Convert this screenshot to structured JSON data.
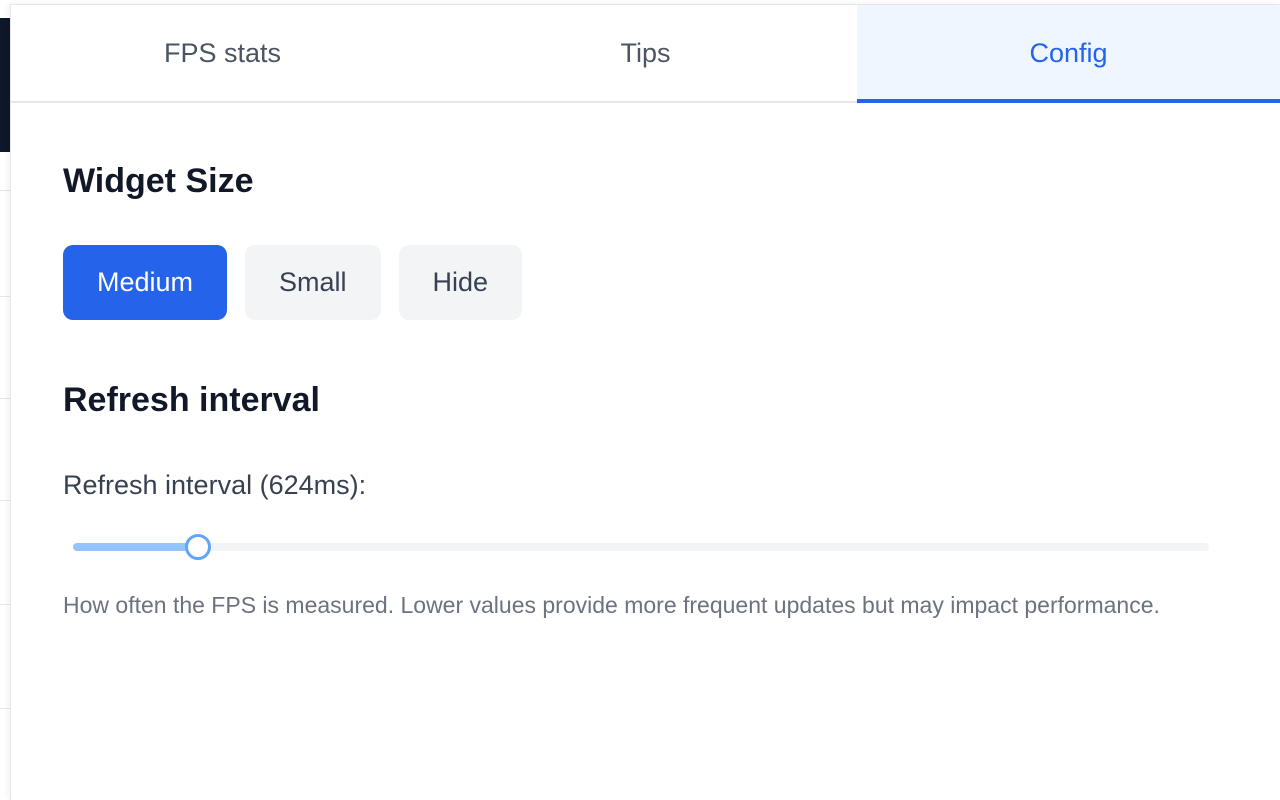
{
  "tabs": [
    {
      "label": "FPS stats",
      "active": false
    },
    {
      "label": "Tips",
      "active": false
    },
    {
      "label": "Config",
      "active": true
    }
  ],
  "widget_size": {
    "title": "Widget Size",
    "options": [
      {
        "label": "Medium",
        "selected": true
      },
      {
        "label": "Small",
        "selected": false
      },
      {
        "label": "Hide",
        "selected": false
      }
    ]
  },
  "refresh": {
    "title": "Refresh interval",
    "slider_label": "Refresh interval (624ms):",
    "slider_fraction": 0.11,
    "help_text": "How often the FPS is measured. Lower values provide more frequent updates but may impact performance."
  },
  "colors": {
    "accent": "#2563eb",
    "slider_fill": "#93c5fd",
    "slider_thumb_border": "#60a5fa"
  }
}
